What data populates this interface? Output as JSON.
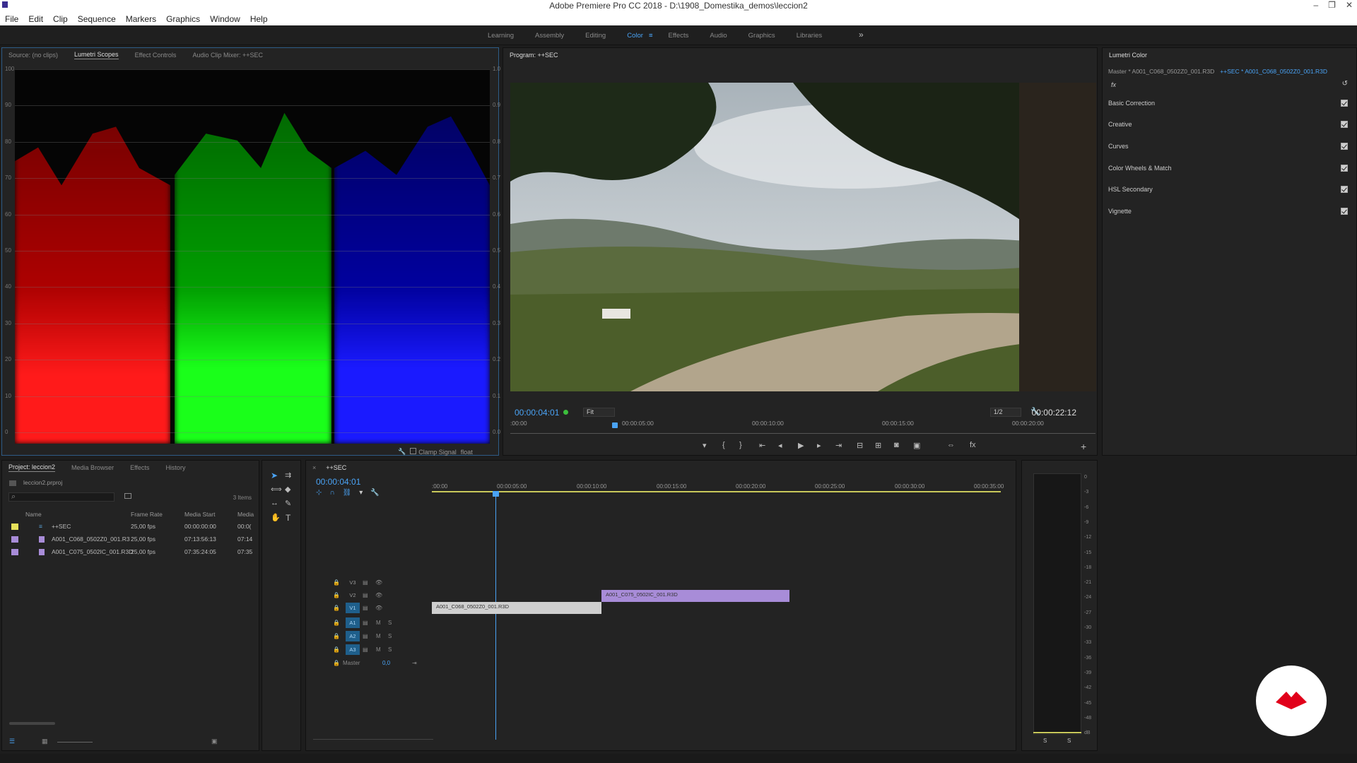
{
  "app": {
    "title": "Adobe Premiere Pro CC 2018 - D:\\1908_Domestika_demos\\leccion2",
    "window_buttons": [
      "–",
      "❐",
      "✕"
    ]
  },
  "menu": [
    "File",
    "Edit",
    "Clip",
    "Sequence",
    "Markers",
    "Graphics",
    "Window",
    "Help"
  ],
  "workspaces": {
    "tabs": [
      "Learning",
      "Assembly",
      "Editing",
      "Color",
      "Effects",
      "Audio",
      "Graphics",
      "Libraries"
    ],
    "active": "Color",
    "more": "»",
    "menu_icon": "≡"
  },
  "left_panel": {
    "tabs": [
      "Source: (no clips)",
      "Lumetri Scopes",
      "Effect Controls",
      "Audio Clip Mixer: ++SEC"
    ],
    "active_tab": "Lumetri Scopes",
    "scope_left_ticks": [
      "100",
      "90",
      "80",
      "70",
      "60",
      "50",
      "40",
      "30",
      "20",
      "10",
      "0"
    ],
    "scope_right_ticks": [
      "1.0",
      "0.9",
      "0.8",
      "0.7",
      "0.6",
      "0.5",
      "0.4",
      "0.3",
      "0.2",
      "0.1",
      "0.0"
    ],
    "clamp_signal": "Clamp Signal",
    "float": "float",
    "colors": {
      "red": "#ff1a1a",
      "green": "#1aff1a",
      "blue": "#1a1aff"
    }
  },
  "program": {
    "title": "Program: ++SEC",
    "timecode_current": "00:00:04:01",
    "timecode_duration": "00:00:22:12",
    "fit": "Fit",
    "resolution": "1/2",
    "ruler": [
      ":00:00",
      "00:00:05:00",
      "00:00:10:00",
      "00:00:15:00",
      "00:00:20:00"
    ]
  },
  "lumetri": {
    "title": "Lumetri Color",
    "master": "Master * A001_C068_0502Z0_001.R3D",
    "seq_clip": "++SEC * A001_C068_0502Z0_001.R3D",
    "fx": "fx",
    "sections": [
      "Basic Correction",
      "Creative",
      "Curves",
      "Color Wheels & Match",
      "HSL Secondary",
      "Vignette"
    ]
  },
  "project": {
    "tabs": [
      "Project: leccion2",
      "Media Browser",
      "Effects",
      "History"
    ],
    "file": "leccion2.prproj",
    "items_count": "3 Items",
    "columns": [
      "Name",
      "Frame Rate",
      "Media Start",
      "Media"
    ],
    "rows": [
      {
        "name": "++SEC",
        "fps": "25,00 fps",
        "start": "00:00:00:00",
        "media": "00:0(",
        "color": "#e6e15a"
      },
      {
        "name": "A001_C068_0502Z0_001.R3",
        "fps": "25,00 fps",
        "start": "07:13:56:13",
        "media": "07:14",
        "color": "#a88cd8"
      },
      {
        "name": "A001_C075_0502IC_001.R3D",
        "fps": "25,00 fps",
        "start": "07:35:24:05",
        "media": "07:35",
        "color": "#a88cd8"
      }
    ]
  },
  "timeline": {
    "title": "++SEC",
    "timecode": "00:00:04:01",
    "ruler": [
      ":00:00",
      "00:00:05:00",
      "00:00:10:00",
      "00:00:15:00",
      "00:00:20:00",
      "00:00:25:00",
      "00:00:30:00",
      "00:00:35:00"
    ],
    "tracks_video": [
      "V3",
      "V2",
      "V1"
    ],
    "tracks_audio": [
      "A1",
      "A2",
      "A3"
    ],
    "master": "Master",
    "master_val": "0,0",
    "clip_v1": "A001_C068_0502Z0_001.R3D",
    "clip_v2": "A001_C075_0502IC_001.R3D",
    "m": "M",
    "s": "S"
  },
  "meter": {
    "ticks": [
      "0",
      "-3",
      "-6",
      "-9",
      "-12",
      "-15",
      "-18",
      "-21",
      "-24",
      "-27",
      "-30",
      "-33",
      "-36",
      "-39",
      "-42",
      "-45",
      "-48",
      "dB"
    ],
    "solo": [
      "S",
      "S"
    ]
  }
}
